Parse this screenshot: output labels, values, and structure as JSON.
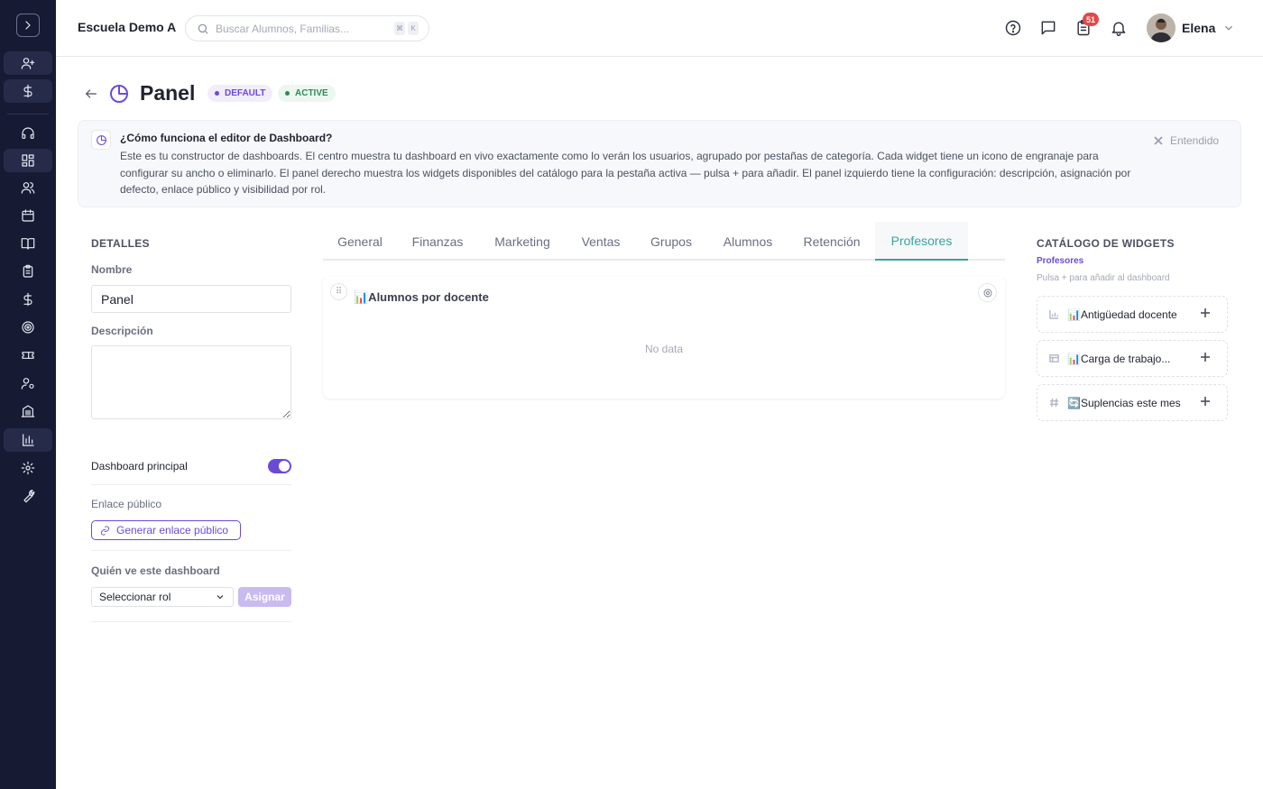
{
  "topbar": {
    "school_name": "Escuela Demo A",
    "search_placeholder": "Buscar Alumnos, Familias...",
    "search_shortcut": [
      "⌘",
      "K"
    ],
    "notification_badge": "51",
    "user_name": "Elena"
  },
  "page": {
    "title": "Panel",
    "badge_default": "DEFAULT",
    "badge_active": "ACTIVE"
  },
  "info_banner": {
    "title": "¿Cómo funciona el editor de Dashboard?",
    "text": "Este es tu constructor de dashboards. El centro muestra tu dashboard en vivo exactamente como lo verán los usuarios, agrupado por pestañas de categoría. Cada widget tiene un icono de engranaje para configurar su ancho o eliminarlo. El panel derecho muestra los widgets disponibles del catálogo para la pestaña activa — pulsa + para añadir. El panel izquierdo tiene la configuración: descripción, asignación por defecto, enlace público y visibilidad por rol.",
    "dismiss_label": "Entendido"
  },
  "details": {
    "heading": "DETALLES",
    "name_label": "Nombre",
    "name_value": "Panel",
    "description_label": "Descripción",
    "description_value": "",
    "main_dashboard_label": "Dashboard principal",
    "main_dashboard_on": true,
    "public_link_label": "Enlace público",
    "public_link_button": "Generar enlace público",
    "visibility_label": "Quién ve este dashboard",
    "role_select_value": "Seleccionar rol",
    "assign_button": "Asignar"
  },
  "tabs": [
    {
      "label": "General"
    },
    {
      "label": "Finanzas"
    },
    {
      "label": "Marketing"
    },
    {
      "label": "Ventas"
    },
    {
      "label": "Grupos"
    },
    {
      "label": "Alumnos"
    },
    {
      "label": "Retención"
    },
    {
      "label": "Profesores"
    }
  ],
  "active_tab": "Profesores",
  "widget": {
    "title": "📊Alumnos por docente",
    "empty_text": "No data"
  },
  "catalog": {
    "heading": "CATÁLOGO DE WIDGETS",
    "category": "Profesores",
    "hint": "Pulsa + para añadir al dashboard",
    "items": [
      {
        "label": "📊Antigüedad docente",
        "icon": "bar-chart-icon"
      },
      {
        "label": "📊Carga de trabajo...",
        "icon": "table-icon"
      },
      {
        "label": "🔄Suplencias este mes",
        "icon": "hash-icon"
      }
    ]
  },
  "colors": {
    "sidebar_bg": "#161a33",
    "accent": "#6c4ad8",
    "active_tab": "#3ba39c",
    "badge_red": "#e04a4a"
  }
}
